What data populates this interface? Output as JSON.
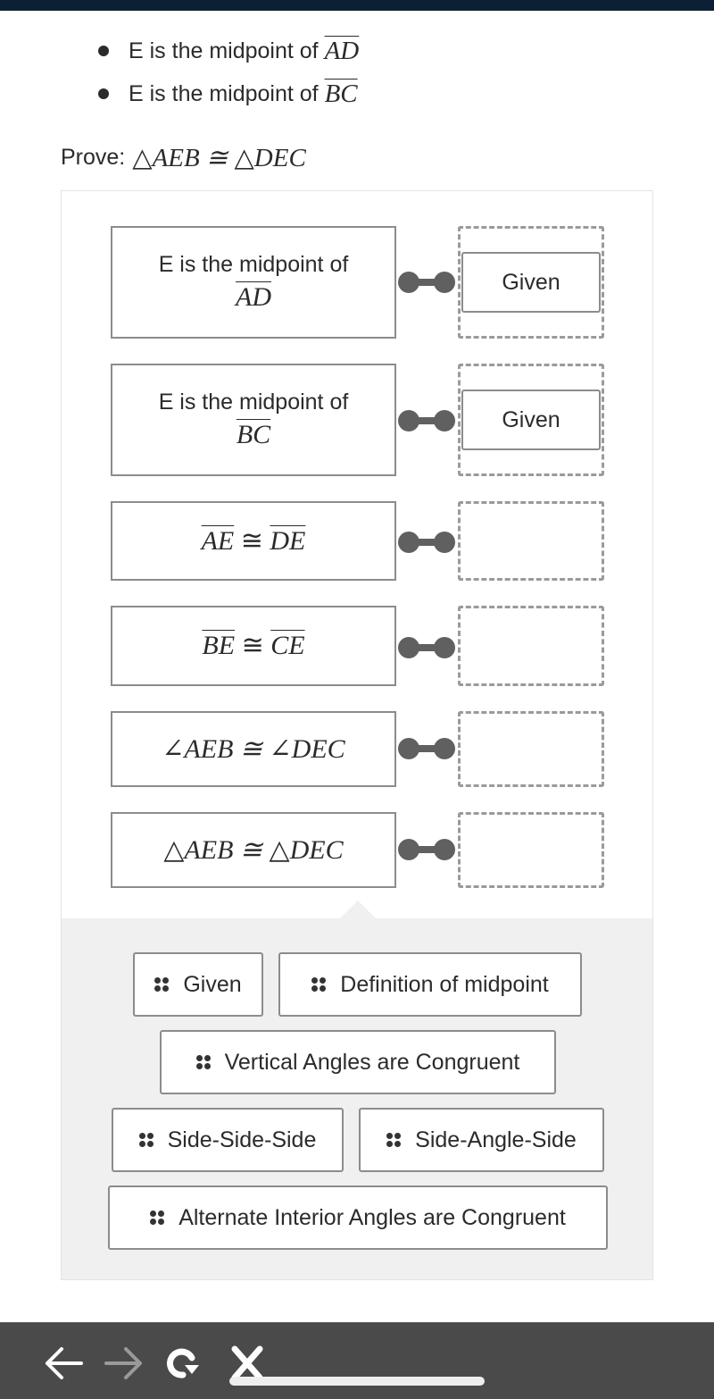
{
  "givens": [
    {
      "text": "E is the midpoint of",
      "segment": "AD"
    },
    {
      "text": "E is the midpoint of",
      "segment": "BC"
    }
  ],
  "prove": {
    "label": "Prove:",
    "statement": "△AEB ≅ △DEC"
  },
  "proof_rows": [
    {
      "statement_text": "E is the midpoint of",
      "statement_segment": "AD",
      "reason": "Given"
    },
    {
      "statement_text": "E is the midpoint of",
      "statement_segment": "BC",
      "reason": "Given"
    },
    {
      "seg1": "AE",
      "rel": "≅",
      "seg2": "DE",
      "reason": ""
    },
    {
      "seg1": "BE",
      "rel": "≅",
      "seg2": "CE",
      "reason": ""
    },
    {
      "statement": "∠AEB ≅ ∠DEC",
      "reason": ""
    },
    {
      "statement": "△AEB ≅ △DEC",
      "reason": ""
    }
  ],
  "reason_bank": [
    {
      "label": "Given",
      "icon": "drag-grip-icon"
    },
    {
      "label": "Definition of midpoint",
      "icon": "drag-grip-icon"
    },
    {
      "label": "Vertical Angles are Congruent",
      "icon": "drag-grip-icon"
    },
    {
      "label": "Side-Side-Side",
      "icon": "drag-grip-icon"
    },
    {
      "label": "Side-Angle-Side",
      "icon": "drag-grip-icon"
    },
    {
      "label": "Alternate Interior Angles are Congruent",
      "icon": "drag-grip-icon"
    }
  ],
  "browser_toolbar": {
    "back_icon": "arrow-left-icon",
    "forward_icon": "arrow-right-icon",
    "reload_icon": "reload-icon",
    "stop_icon": "close-icon"
  },
  "colors": {
    "top_bar": "#0c2035",
    "toolbar": "#4a4a4a",
    "connector": "#606060",
    "bank_background": "#f0f0f0"
  }
}
